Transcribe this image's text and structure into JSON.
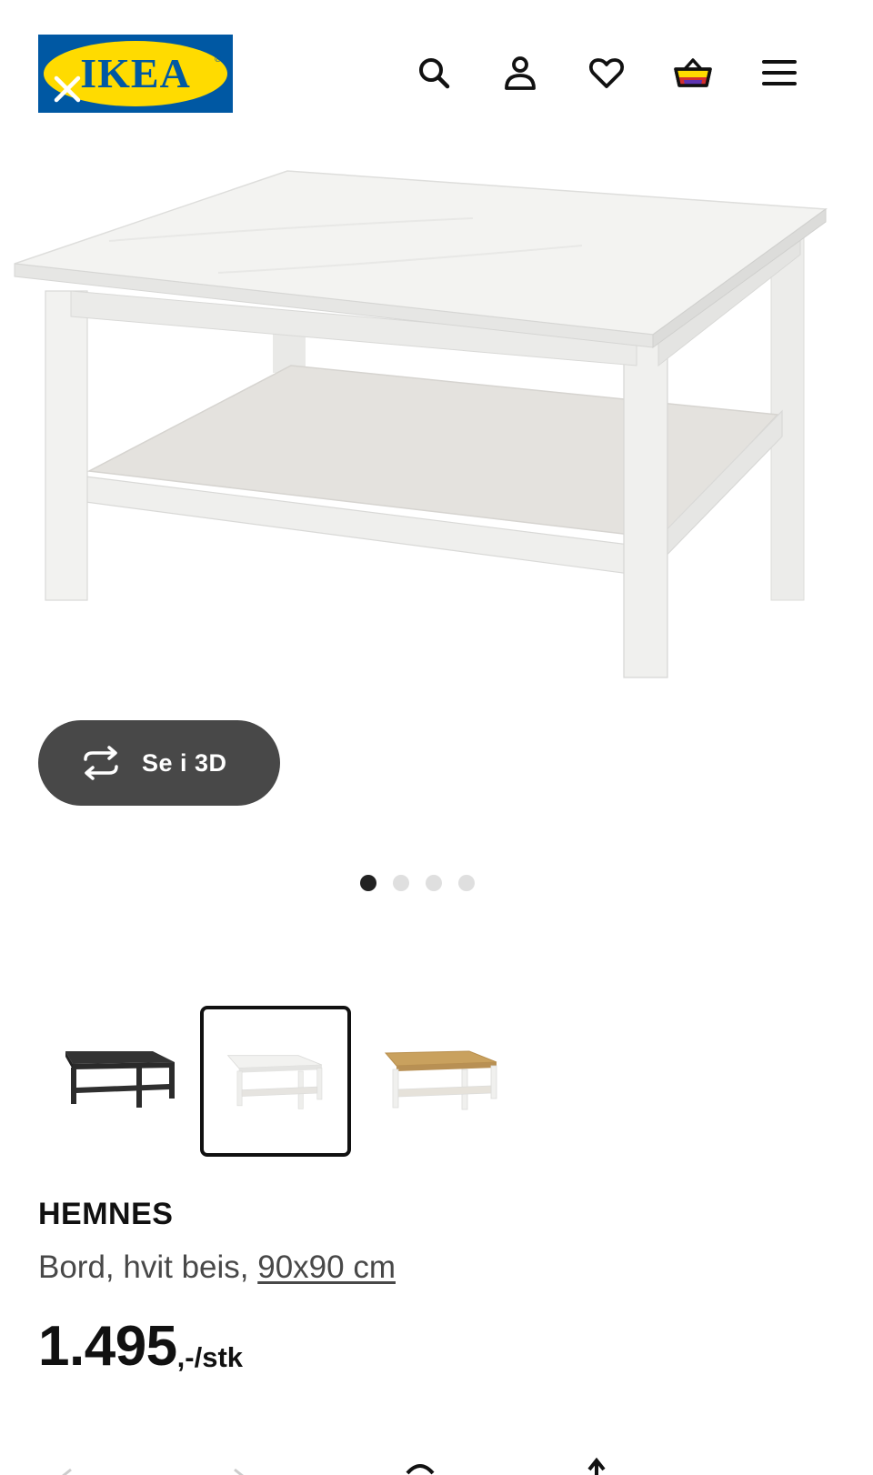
{
  "header": {
    "logo_text": "IKEA",
    "logo_registered": "®",
    "icons": [
      "search-icon",
      "user-icon",
      "heart-icon",
      "basket-icon",
      "menu-icon"
    ]
  },
  "gallery": {
    "view_3d_label": "Se i 3D",
    "slide_count": 4,
    "active_slide": 1
  },
  "variants": {
    "items": [
      "black-brown",
      "white-stain",
      "white-stain-light-brown"
    ],
    "selected_index": 1
  },
  "product": {
    "name": "HEMNES",
    "description": "Bord, hvit beis, ",
    "size": "90x90 cm",
    "price": "1.495",
    "price_unit": ",-/stk"
  },
  "colors": {
    "ikea_blue": "#0058a3",
    "ikea_yellow": "#ffdb00",
    "button_dark": "#484848"
  }
}
